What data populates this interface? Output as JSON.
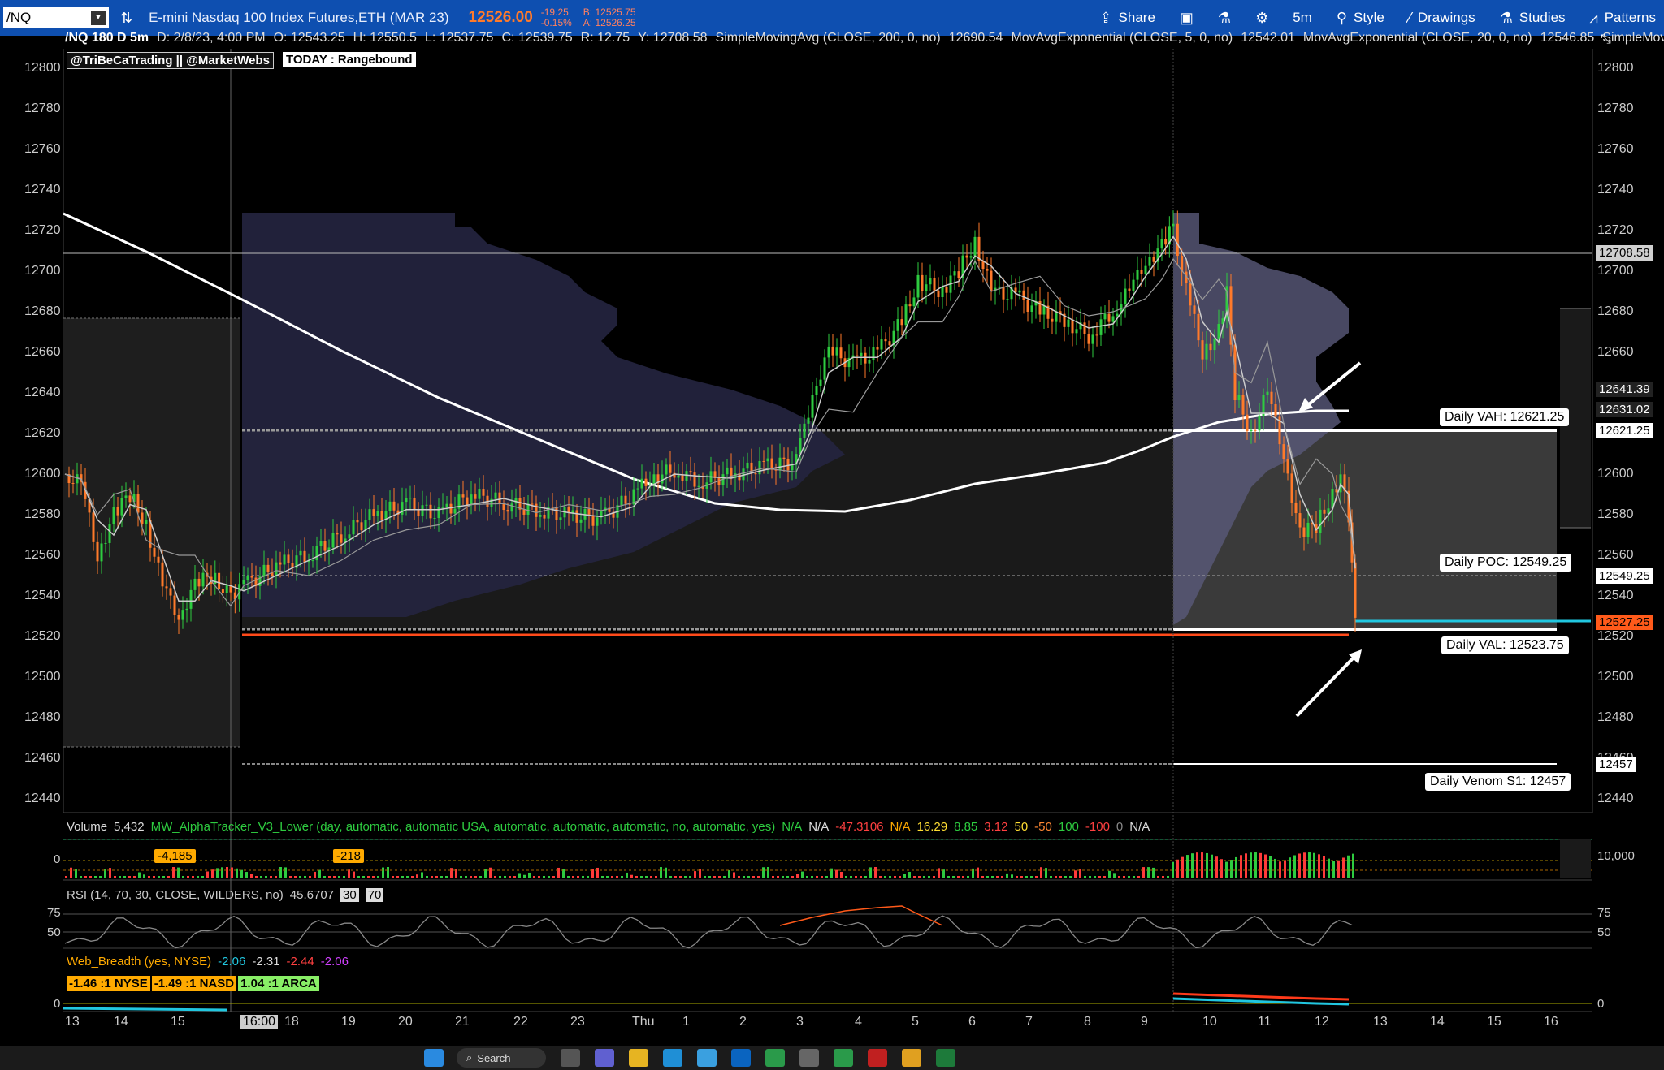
{
  "toolbar": {
    "symbol": "/NQ",
    "description": "E-mini Nasdaq 100 Index Futures,ETH (MAR 23)",
    "last_price": "12526.00",
    "change": "-19.25",
    "change_pct": "-0.15%",
    "bid": "B: 12525.75",
    "ask": "A: 12526.25",
    "share_label": "Share",
    "timeframe_label": "5m",
    "style_label": "Style",
    "drawings_label": "Drawings",
    "studies_label": "Studies",
    "patterns_label": "Patterns"
  },
  "infobar": {
    "symbol_period": "/NQ 180 D 5m",
    "date": "D: 2/8/23, 4:00 PM",
    "open": "O: 12543.25",
    "high": "H: 12550.5",
    "low": "L: 12537.75",
    "close": "C: 12539.75",
    "range": "R: 12.75",
    "y": "Y: 12708.58",
    "sma200": "SimpleMovingAvg (CLOSE, 200, 0, no)",
    "sma200_val": "12690.54",
    "ema5": "MovAvgExponential (CLOSE, 5, 0, no)",
    "ema5_val": "12542.01",
    "ema20": "MovAvgExponential (CLOSE, 20, 0, no)",
    "ema20_val": "12546.85",
    "more": "SimpleMoving..."
  },
  "tags": {
    "handle": "@TriBeCaTrading || @MarketWebs",
    "today": "TODAY : Rangebound"
  },
  "levels": {
    "vah": "Daily VAH: 12621.25",
    "poc": "Daily POC: 12549.25",
    "val": "Daily VAL: 12523.75",
    "venom": "Daily Venom S1: 12457"
  },
  "price_tags": [
    {
      "text": "12708.58",
      "bg": "#cfcfcf",
      "fg": "#000"
    },
    {
      "text": "12641.39",
      "bg": "#222",
      "fg": "#fff"
    },
    {
      "text": "12631.02",
      "bg": "#222",
      "fg": "#fff"
    },
    {
      "text": "12621.25",
      "bg": "#fff",
      "fg": "#000"
    },
    {
      "text": "12549.25",
      "bg": "#fff",
      "fg": "#000"
    },
    {
      "text": "12527.25",
      "bg": "#ff5a1a",
      "fg": "#000"
    },
    {
      "text": "12457",
      "bg": "#fff",
      "fg": "#000"
    }
  ],
  "y_axis": [
    "12800",
    "12780",
    "12760",
    "12740",
    "12720",
    "12700",
    "12680",
    "12660",
    "12640",
    "12620",
    "12600",
    "12580",
    "12560",
    "12540",
    "12520",
    "12500",
    "12480",
    "12460",
    "12440"
  ],
  "x_axis": [
    "13",
    "14",
    "15",
    "16:00",
    "18",
    "19",
    "20",
    "21",
    "22",
    "23",
    "Thu",
    "1",
    "2",
    "3",
    "4",
    "5",
    "6",
    "7",
    "8",
    "9",
    "10",
    "11",
    "12",
    "13",
    "14",
    "15",
    "16"
  ],
  "volume_panel": {
    "label": "Volume",
    "value": "5,432",
    "study": "MW_AlphaTracker_V3_Lower (day, automatic, automatic USA, automatic, automatic, automatic, no, automatic, yes)",
    "vals": [
      "N/A",
      "N/A",
      "-47.3106",
      "N/A",
      "16.29",
      "8.85",
      "3.12",
      "50",
      "-50",
      "100",
      "-100",
      "0",
      "N/A"
    ],
    "tag1": "-4,185",
    "tag2": "-218",
    "axis_right": "10,000",
    "axis_left": "0"
  },
  "rsi_panel": {
    "label": "RSI (14, 70, 30, CLOSE, WILDERS, no)",
    "value": "45.6707",
    "lo": "30",
    "hi": "70",
    "axis_75": "75",
    "axis_50": "50"
  },
  "breadth_panel": {
    "label": "Web_Breadth (yes, NYSE)",
    "v1": "-2.06",
    "v2": "-2.31",
    "v3": "-2.44",
    "v4": "-2.06",
    "nyse": "-1.46 :1 NYSE",
    "nasd": "-1.49 :1 NASD",
    "arca": "1.04 :1 ARCA",
    "axis": "0"
  },
  "taskbar": {
    "search": "Search"
  }
}
